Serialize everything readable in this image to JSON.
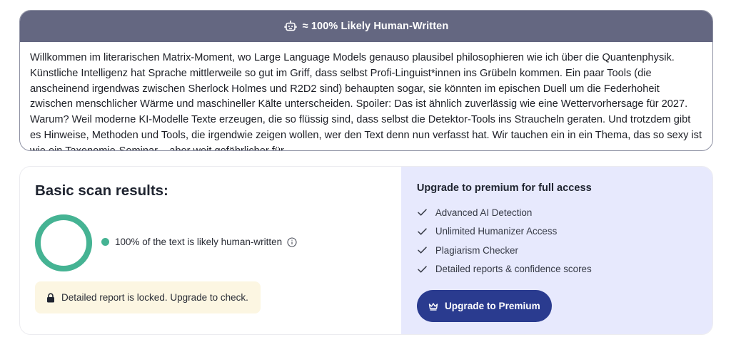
{
  "text_panel": {
    "header_label": "≈ 100% Likely Human-Written",
    "header_icon": "robot-icon",
    "header_bg": "#646781",
    "body_text": "Willkommen im literarischen Matrix-Moment, wo Large Language Models genauso plausibel philosophieren wie ich über die Quantenphysik. Künstliche Intelligenz hat Sprache mittlerweile so gut im Griff, dass selbst Profi-Linguist*innen ins Grübeln kommen. Ein paar Tools (die anscheinend irgendwas zwischen Sherlock Holmes und R2D2 sind) behaupten sogar, sie könnten im epischen Duell um die Federhoheit zwischen menschlicher Wärme und maschineller Kälte unterscheiden. Spoiler: Das ist ähnlich zuverlässig wie eine Wettervorhersage für 2027. Warum? Weil moderne KI-Modelle Texte erzeugen, die so flüssig sind, dass selbst die Detektor-Tools ins Straucheln geraten. Und trotzdem gibt es Hinweise, Methoden und Tools, die irgendwie zeigen wollen, wer den Text denn nun verfasst hat. Wir tauchen ein in ein Thema, das so sexy ist wie ein Taxonomie-Seminar – aber weit gefährlicher für"
  },
  "scan": {
    "title": "Basic scan results:",
    "human_fraction": 1.0,
    "result_text": "100% of the text is likely human-written",
    "result_color": "#45b393",
    "locked_text": "Detailed report is locked. Upgrade to check."
  },
  "upgrade": {
    "title": "Upgrade to premium for full access",
    "features": [
      "Advanced AI Detection",
      "Unlimited Humanizer Access",
      "Plagiarism Checker",
      "Detailed reports & confidence scores"
    ],
    "button_label": "Upgrade to Premium",
    "button_color": "#2a3b8f",
    "panel_bg": "#e7e9fd"
  }
}
